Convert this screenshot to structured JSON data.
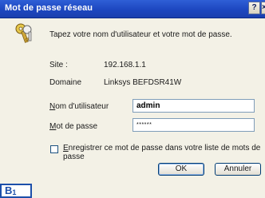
{
  "window": {
    "title": "Mot de passe réseau",
    "help_label": "?",
    "close_label": "×"
  },
  "dialog": {
    "message": "Tapez votre nom d'utilisateur et votre mot de passe.",
    "site_label": "Site :",
    "site_value": "192.168.1.1",
    "domain_label": "Domaine",
    "domain_value": "Linksys  BEFDSR41W",
    "username_label_accel": "N",
    "username_label_rest": "om d'utilisateur",
    "username_value": "admin",
    "password_label_accel": "M",
    "password_label_rest": "ot de passe",
    "password_mask": "******",
    "remember_label_accel": "E",
    "remember_label_rest": "nregistrer ce mot de passe dans votre liste de mots de passe",
    "remember_checked": false,
    "ok_label": "OK",
    "cancel_label": "Annuler"
  },
  "badge": {
    "letter": "B",
    "number": "1"
  },
  "icons": {
    "dialog_icon": "keys-icon"
  },
  "colors": {
    "title_bar": "#1d47c0",
    "dialog_background": "#f3f1e6",
    "badge_border": "#1c4faa"
  }
}
